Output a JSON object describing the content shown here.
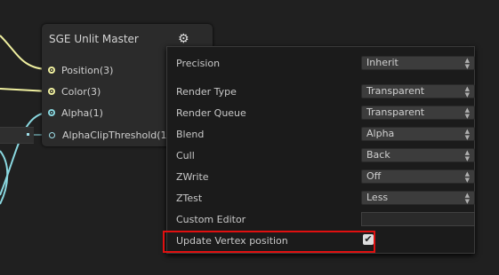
{
  "node": {
    "title": "SGE Unlit Master",
    "gear_icon": "gear-icon",
    "ports": [
      {
        "label": "Position(3)",
        "kind": "yellow"
      },
      {
        "label": "Color(3)",
        "kind": "yellow"
      },
      {
        "label": "Alpha(1)",
        "kind": "cyan"
      },
      {
        "label": "AlphaClipThreshold(1)",
        "kind": "hollow"
      }
    ]
  },
  "settings": {
    "precision": {
      "label": "Precision",
      "value": "Inherit"
    },
    "render_type": {
      "label": "Render Type",
      "value": "Transparent"
    },
    "render_queue": {
      "label": "Render Queue",
      "value": "Transparent"
    },
    "blend": {
      "label": "Blend",
      "value": "Alpha"
    },
    "cull": {
      "label": "Cull",
      "value": "Back"
    },
    "zwrite": {
      "label": "ZWrite",
      "value": "Off"
    },
    "ztest": {
      "label": "ZTest",
      "value": "Less"
    },
    "custom_editor": {
      "label": "Custom Editor",
      "value": ""
    },
    "update_vertex": {
      "label": "Update Vertex position",
      "checked": true
    }
  },
  "colors": {
    "wire_yellow": "#f0f0a0",
    "wire_cyan": "#8ad8e0",
    "highlight": "#e01010"
  }
}
